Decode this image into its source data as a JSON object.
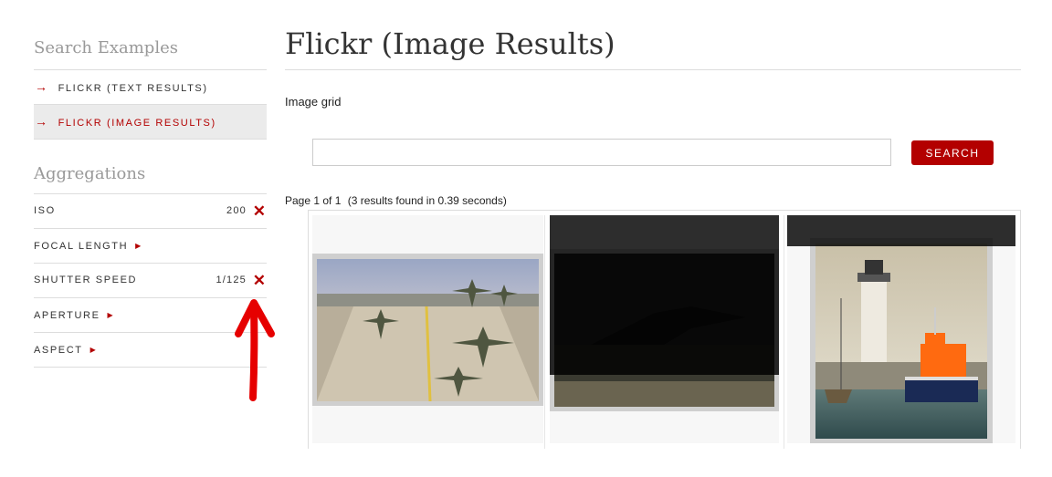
{
  "sidebar": {
    "search_heading": "Search Examples",
    "nav": [
      {
        "label": "FLICKR (TEXT RESULTS)",
        "active": false
      },
      {
        "label": "FLICKR (IMAGE RESULTS)",
        "active": true
      }
    ],
    "arrow_glyph": "→",
    "agg_heading": "Aggregations",
    "aggregations": [
      {
        "label": "ISO",
        "value": "200",
        "remove": "✕"
      },
      {
        "label": "FOCAL LENGTH",
        "expand": "▶"
      },
      {
        "label": "SHUTTER SPEED",
        "value": "1/125",
        "remove": "✕"
      },
      {
        "label": "APERTURE",
        "expand": "▶"
      },
      {
        "label": "ASPECT",
        "expand": "▶"
      }
    ]
  },
  "main": {
    "title": "Flickr (Image Results)",
    "section_label": "Image grid",
    "search": {
      "value": "",
      "placeholder": "",
      "button_label": "SEARCH"
    },
    "pager": {
      "text": "Page 1 of 1",
      "result_info": "(3 results found in 0.39 seconds)"
    }
  },
  "images": [
    {
      "alt": "Four camouflaged jet aircraft taxiing on a runway"
    },
    {
      "alt": "Jet aircraft taking off, darkened with overlay"
    },
    {
      "alt": "Lighthouse and orange lifeboat in a harbour"
    }
  ],
  "colors": {
    "accent": "#b30000",
    "annotation": "#e60000",
    "active_bg": "#ebebeb"
  }
}
